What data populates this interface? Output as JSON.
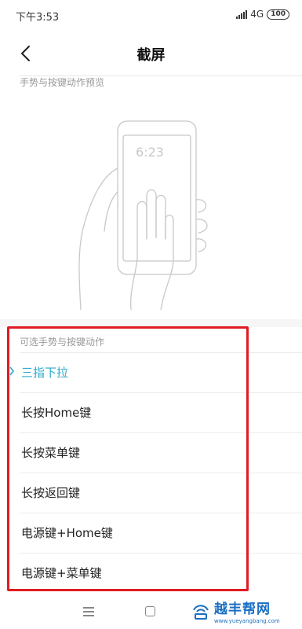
{
  "status_bar": {
    "time": "下午3:53",
    "network": "4G",
    "battery": "100"
  },
  "header": {
    "title": "截屏"
  },
  "preview": {
    "label": "手势与按键动作预览",
    "phone_time": "6:23"
  },
  "options": {
    "label": "可选手势与按键动作",
    "items": [
      {
        "label": "三指下拉",
        "selected": true
      },
      {
        "label": "长按Home键",
        "selected": false
      },
      {
        "label": "长按菜单键",
        "selected": false
      },
      {
        "label": "长按返回键",
        "selected": false
      },
      {
        "label": "电源键+Home键",
        "selected": false
      },
      {
        "label": "电源键+菜单键",
        "selected": false
      }
    ]
  },
  "watermark": {
    "text": "越丰帮网",
    "url": "www.yueyangbang.com"
  },
  "colors": {
    "accent": "#2aa8c9",
    "annotation": "#e01b22"
  }
}
